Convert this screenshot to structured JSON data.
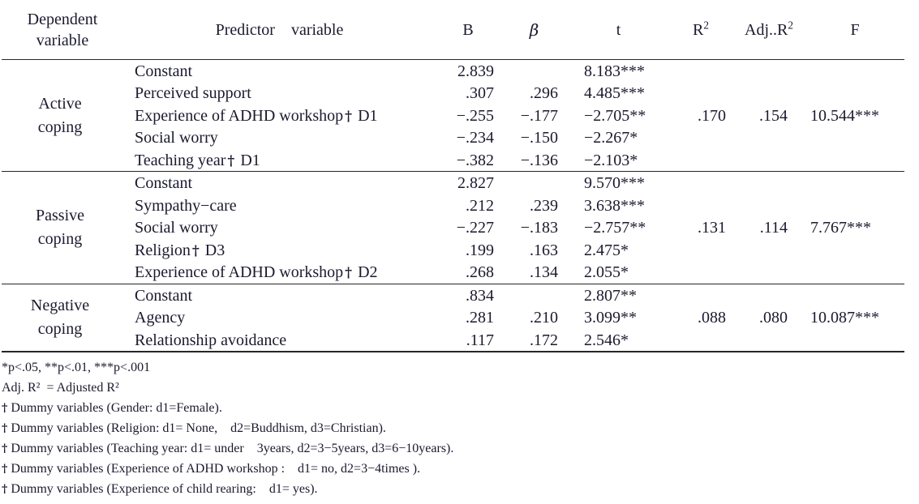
{
  "table": {
    "headers": {
      "dependent_variable": "Dependent\nvariable",
      "predictor_variable": "Predictor    variable",
      "b": "B",
      "beta": "β",
      "t": "t",
      "r2": "R",
      "r2_sup": "2",
      "adj_r2": "Adj..R",
      "adj_r2_sup": "2",
      "f": "F"
    },
    "blocks": [
      {
        "dependent": "Active\ncoping",
        "r2": ".170",
        "adj_r2": ".154",
        "f": "10.544***",
        "rows": [
          {
            "predictor": "Constant",
            "dagger": false,
            "dummy": "",
            "b": "2.839",
            "beta": "",
            "t": "8.183***"
          },
          {
            "predictor": "Perceived support",
            "dagger": false,
            "dummy": "",
            "b": ".307",
            "beta": ".296",
            "t": "4.485***"
          },
          {
            "predictor": "Experience of ADHD workshop",
            "dagger": true,
            "dummy": "D1",
            "b": "−.255",
            "beta": "−.177",
            "t": "−2.705**"
          },
          {
            "predictor": "Social worry",
            "dagger": false,
            "dummy": "",
            "b": "−.234",
            "beta": "−.150",
            "t": "−2.267*"
          },
          {
            "predictor": "Teaching year",
            "dagger": true,
            "dummy": "D1",
            "b": "−.382",
            "beta": "−.136",
            "t": "−2.103*"
          }
        ]
      },
      {
        "dependent": "Passive\ncoping",
        "r2": ".131",
        "adj_r2": ".114",
        "f": "7.767***",
        "rows": [
          {
            "predictor": "Constant",
            "dagger": false,
            "dummy": "",
            "b": "2.827",
            "beta": "",
            "t": "9.570***"
          },
          {
            "predictor": "Sympathy−care",
            "dagger": false,
            "dummy": "",
            "b": ".212",
            "beta": ".239",
            "t": "3.638***"
          },
          {
            "predictor": "Social worry",
            "dagger": false,
            "dummy": "",
            "b": "−.227",
            "beta": "−.183",
            "t": "−2.757**"
          },
          {
            "predictor": "Religion",
            "dagger": true,
            "dummy": "D3",
            "b": ".199",
            "beta": ".163",
            "t": "2.475*"
          },
          {
            "predictor": "Experience of ADHD workshop",
            "dagger": true,
            "dummy": "D2",
            "b": ".268",
            "beta": ".134",
            "t": "2.055*"
          }
        ]
      },
      {
        "dependent": "Negative\ncoping",
        "r2": ".088",
        "adj_r2": ".080",
        "f": "10.087***",
        "rows": [
          {
            "predictor": "Constant",
            "dagger": false,
            "dummy": "",
            "b": ".834",
            "beta": "",
            "t": "2.807**"
          },
          {
            "predictor": "Agency",
            "dagger": false,
            "dummy": "",
            "b": ".281",
            "beta": ".210",
            "t": "3.099**"
          },
          {
            "predictor": "Relationship avoidance",
            "dagger": false,
            "dummy": "",
            "b": ".117",
            "beta": ".172",
            "t": "2.546*"
          }
        ]
      }
    ]
  },
  "footnotes": [
    {
      "dagger": false,
      "text": "*p<.05, **p<.01, ***p<.001"
    },
    {
      "dagger": false,
      "text": "Adj. R²  = Adjusted R²"
    },
    {
      "dagger": true,
      "text": "Dummy variables (Gender: d1=Female)."
    },
    {
      "dagger": true,
      "text": "Dummy variables (Religion: d1= None,    d2=Buddhism, d3=Christian)."
    },
    {
      "dagger": true,
      "text": "Dummy variables (Teaching year: d1= under    3years, d2=3−5years, d3=6−10years)."
    },
    {
      "dagger": true,
      "text": "Dummy variables (Experience of ADHD workshop :    d1= no, d2=3−4times )."
    },
    {
      "dagger": true,
      "text": "Dummy variables (Experience of child rearing:    d1= yes)."
    }
  ]
}
